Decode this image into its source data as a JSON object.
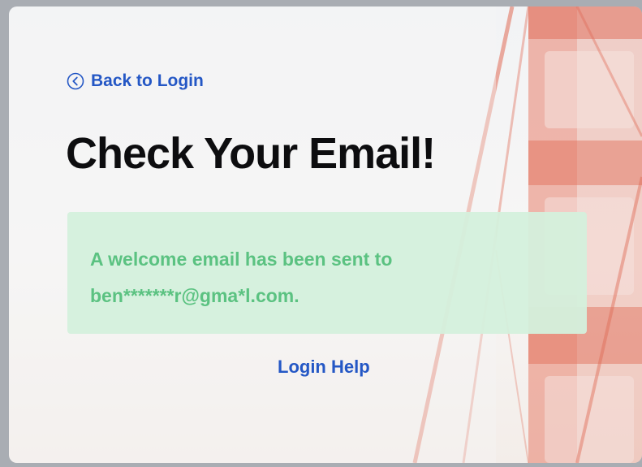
{
  "back_link": {
    "label": "Back to Login",
    "icon": "chevron-left-circle-icon"
  },
  "page": {
    "title": "Check Your Email!"
  },
  "notice": {
    "line1": "A welcome email has been sent to",
    "line2": "ben*******r@gma*l.com.",
    "colors": {
      "background": "#d6f1de",
      "text": "#5bc281"
    }
  },
  "help_link": {
    "label": "Login Help"
  },
  "colors": {
    "link": "#2457c5",
    "title": "#0d0d0f",
    "bridge": "#e06a55"
  }
}
